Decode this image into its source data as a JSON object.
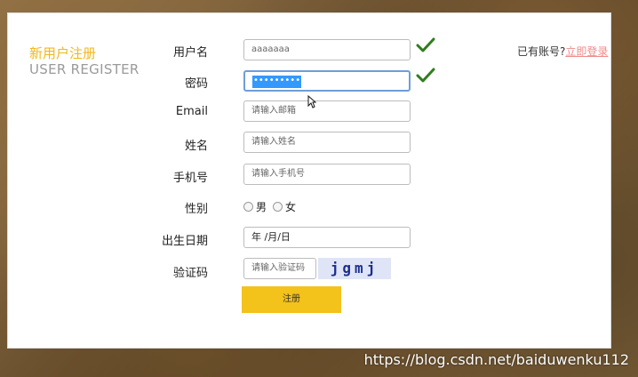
{
  "header": {
    "title_cn": "新用户注册",
    "title_en": "USER REGISTER",
    "login_prompt": "已有账号?",
    "login_link": "立即登录"
  },
  "form": {
    "username": {
      "label": "用户名",
      "value": "aaaaaaa",
      "valid": true
    },
    "password": {
      "label": "密码",
      "value": "•••••••••",
      "valid": true
    },
    "email": {
      "label": "Email",
      "placeholder": "请输入邮箱"
    },
    "name": {
      "label": "姓名",
      "placeholder": "请输入姓名"
    },
    "phone": {
      "label": "手机号",
      "placeholder": "请输入手机号"
    },
    "gender": {
      "label": "性别",
      "options": [
        "男",
        "女"
      ]
    },
    "birthdate": {
      "label": "出生日期",
      "value": "年 /月/日"
    },
    "captcha": {
      "label": "验证码",
      "placeholder": "请输入验证码",
      "image_text": "jgmj"
    },
    "submit_label": "注册"
  },
  "watermark": "https://blog.csdn.net/baiduwenku112",
  "colors": {
    "accent": "#f2b71b",
    "button": "#f3c21b",
    "link": "#f08a8a",
    "check": "#2f7d1f"
  },
  "icons": {
    "check": "checkmark-icon",
    "cursor": "mouse-cursor-icon"
  }
}
